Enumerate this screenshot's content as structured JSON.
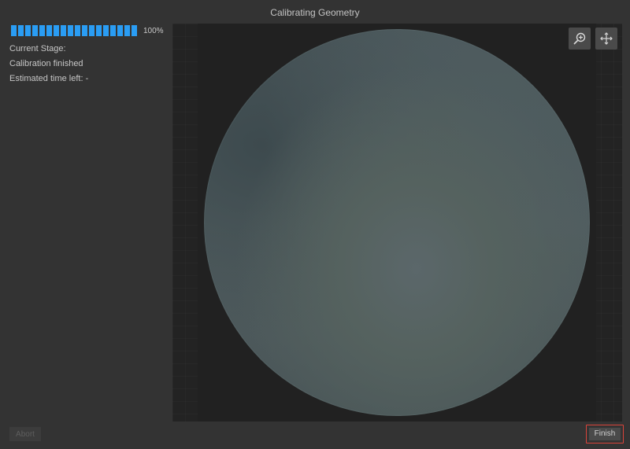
{
  "window": {
    "title": "Calibrating Geometry"
  },
  "progress": {
    "value_percent": 100,
    "label": "100%",
    "color": "#2a9df4"
  },
  "status": {
    "stage_label": "Current Stage:",
    "stage_value": "Calibration finished",
    "time_left": "Estimated time left: -"
  },
  "viewport": {
    "tools": [
      {
        "name": "zoom",
        "icon": "zoom-in-icon"
      },
      {
        "name": "pan",
        "icon": "move-arrows-icon"
      }
    ]
  },
  "buttons": {
    "abort_label": "Abort",
    "finish_label": "Finish",
    "finish_focus_color": "#d9443a"
  }
}
